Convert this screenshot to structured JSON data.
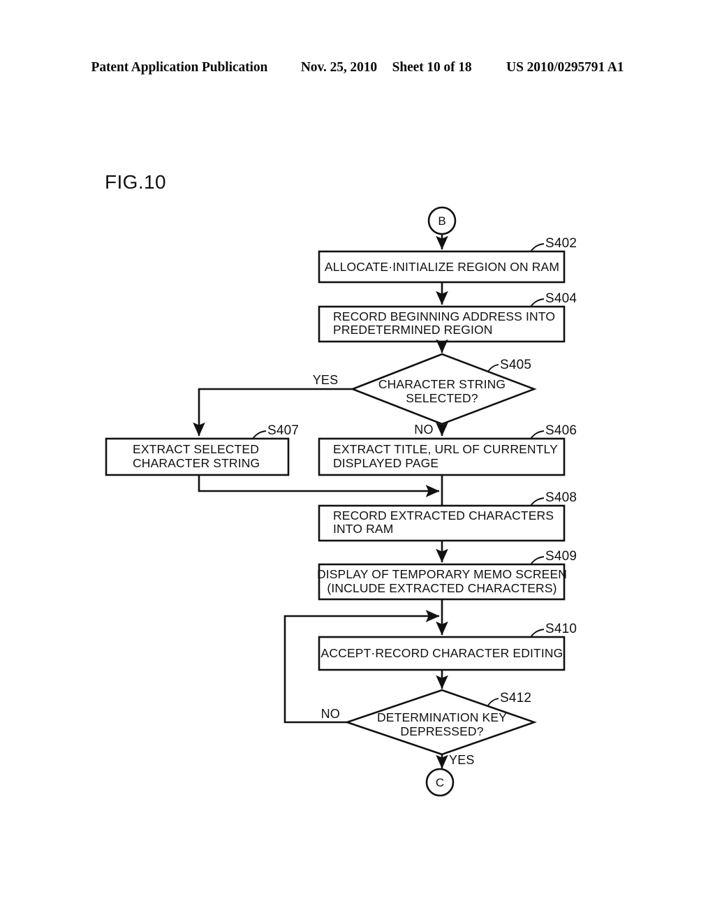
{
  "header": {
    "publication": "Patent Application Publication",
    "date": "Nov. 25, 2010",
    "sheet": "Sheet 10 of 18",
    "patent_number": "US 2010/0295791 A1"
  },
  "figure": {
    "label": "FIG.10"
  },
  "chart_data": {
    "type": "diagram",
    "diagram_kind": "flowchart",
    "title": "FIG.10",
    "connectors": [
      {
        "id": "B",
        "text": "B",
        "role": "entry"
      },
      {
        "id": "C",
        "text": "C",
        "role": "exit"
      }
    ],
    "nodes": [
      {
        "id": "S402",
        "step": "S402",
        "shape": "process",
        "align": "center",
        "lines": [
          "ALLOCATE·INITIALIZE REGION ON RAM"
        ]
      },
      {
        "id": "S404",
        "step": "S404",
        "shape": "process",
        "align": "left",
        "lines": [
          "RECORD BEGINNING ADDRESS INTO",
          "PREDETERMINED REGION"
        ]
      },
      {
        "id": "S405",
        "step": "S405",
        "shape": "decision",
        "align": "center",
        "lines": [
          "CHARACTER STRING",
          "SELECTED?"
        ]
      },
      {
        "id": "S407",
        "step": "S407",
        "shape": "process",
        "align": "left",
        "lines": [
          "EXTRACT SELECTED",
          "CHARACTER STRING"
        ]
      },
      {
        "id": "S406",
        "step": "S406",
        "shape": "process",
        "align": "left",
        "lines": [
          "EXTRACT TITLE, URL OF CURRENTLY",
          "DISPLAYED PAGE"
        ]
      },
      {
        "id": "S408",
        "step": "S408",
        "shape": "process",
        "align": "left",
        "lines": [
          "RECORD EXTRACTED CHARACTERS",
          "INTO RAM"
        ]
      },
      {
        "id": "S409",
        "step": "S409",
        "shape": "process",
        "align": "center",
        "lines": [
          "DISPLAY OF TEMPORARY MEMO SCREEN",
          "(INCLUDE EXTRACTED CHARACTERS)"
        ]
      },
      {
        "id": "S410",
        "step": "S410",
        "shape": "process",
        "align": "center",
        "lines": [
          "ACCEPT·RECORD CHARACTER EDITING"
        ]
      },
      {
        "id": "S412",
        "step": "S412",
        "shape": "decision",
        "align": "center",
        "lines": [
          "DETERMINATION KEY",
          "DEPRESSED?"
        ]
      }
    ],
    "edges": [
      {
        "from": "B",
        "to": "S402",
        "label": ""
      },
      {
        "from": "S402",
        "to": "S404",
        "label": ""
      },
      {
        "from": "S404",
        "to": "S405",
        "label": ""
      },
      {
        "from": "S405",
        "to": "S407",
        "label": "YES"
      },
      {
        "from": "S405",
        "to": "S406",
        "label": "NO"
      },
      {
        "from": "S407",
        "to": "S408",
        "label": ""
      },
      {
        "from": "S406",
        "to": "S408",
        "label": ""
      },
      {
        "from": "S408",
        "to": "S409",
        "label": ""
      },
      {
        "from": "S409",
        "to": "S410",
        "label": ""
      },
      {
        "from": "S410",
        "to": "S412",
        "label": ""
      },
      {
        "from": "S412",
        "to": "S410",
        "label": "NO"
      },
      {
        "from": "S412",
        "to": "C",
        "label": "YES"
      }
    ],
    "branch_labels": {
      "s405_yes": "YES",
      "s405_no": "NO",
      "s412_no": "NO",
      "s412_yes": "YES"
    },
    "step_labels": [
      "S402",
      "S404",
      "S405",
      "S407",
      "S406",
      "S408",
      "S409",
      "S410",
      "S412"
    ],
    "colors": {
      "line": "#111111",
      "fill": "#ffffff",
      "background": "#ffffff"
    }
  }
}
